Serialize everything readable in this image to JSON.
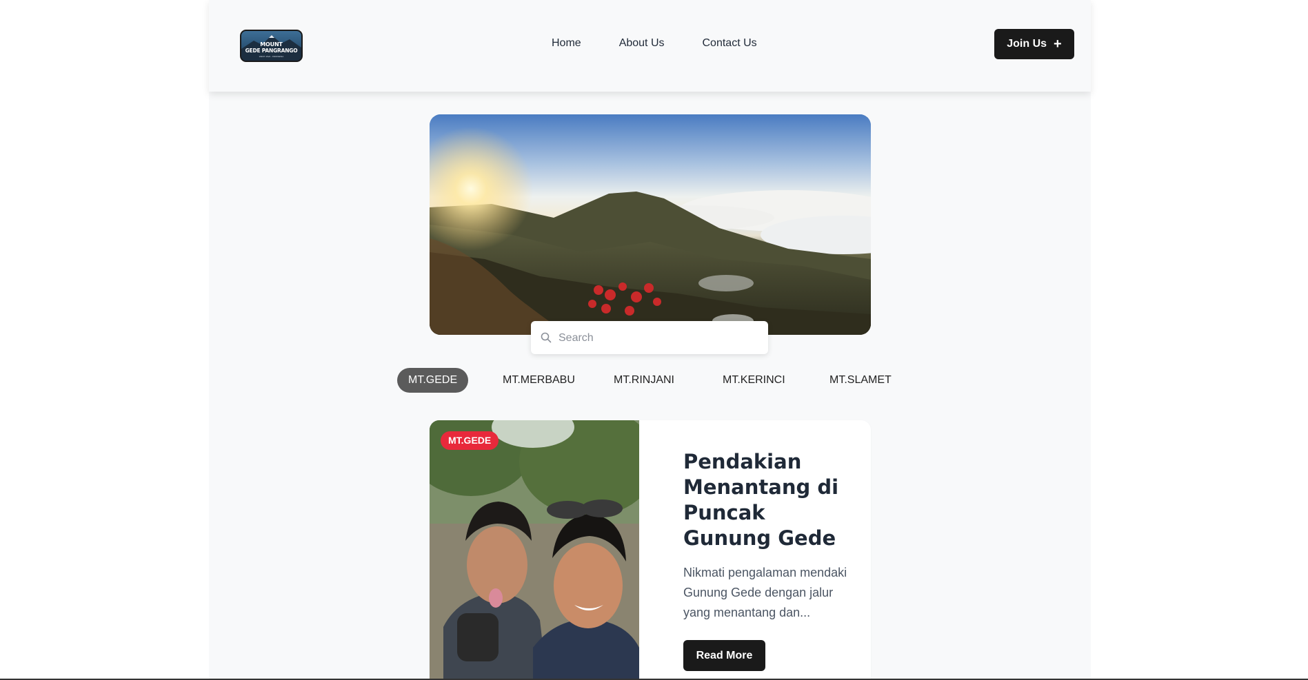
{
  "header": {
    "logo": {
      "line1": "MOUNT",
      "line2": "GEDE PANGRANGO",
      "tagline": "WEST JAVA - INDONESIA"
    },
    "nav": [
      {
        "label": "Home"
      },
      {
        "label": "About Us"
      },
      {
        "label": "Contact Us"
      }
    ],
    "join_label": "Join Us",
    "join_icon": "plus-icon"
  },
  "search": {
    "placeholder": "Search",
    "icon": "search-icon"
  },
  "filters": [
    {
      "label": "MT.GEDE",
      "active": true
    },
    {
      "label": "MT.MERBABU",
      "active": false
    },
    {
      "label": "MT.RINJANI",
      "active": false
    },
    {
      "label": "MT.KERINCI",
      "active": false
    },
    {
      "label": "MT.SLAMET",
      "active": false
    }
  ],
  "card": {
    "tag": "MT.GEDE",
    "title": "Pendakian Menantang di Puncak Gunung Gede",
    "description": "Nikmati pengalaman mendaki Gunung Gede dengan jalur yang menantang dan...",
    "button_label": "Read More"
  },
  "colors": {
    "primary_dark": "#1a1a1a",
    "active_chip": "#5b5b5b",
    "tag_red": "#e8293b",
    "page_bg": "#f8f9fa"
  }
}
